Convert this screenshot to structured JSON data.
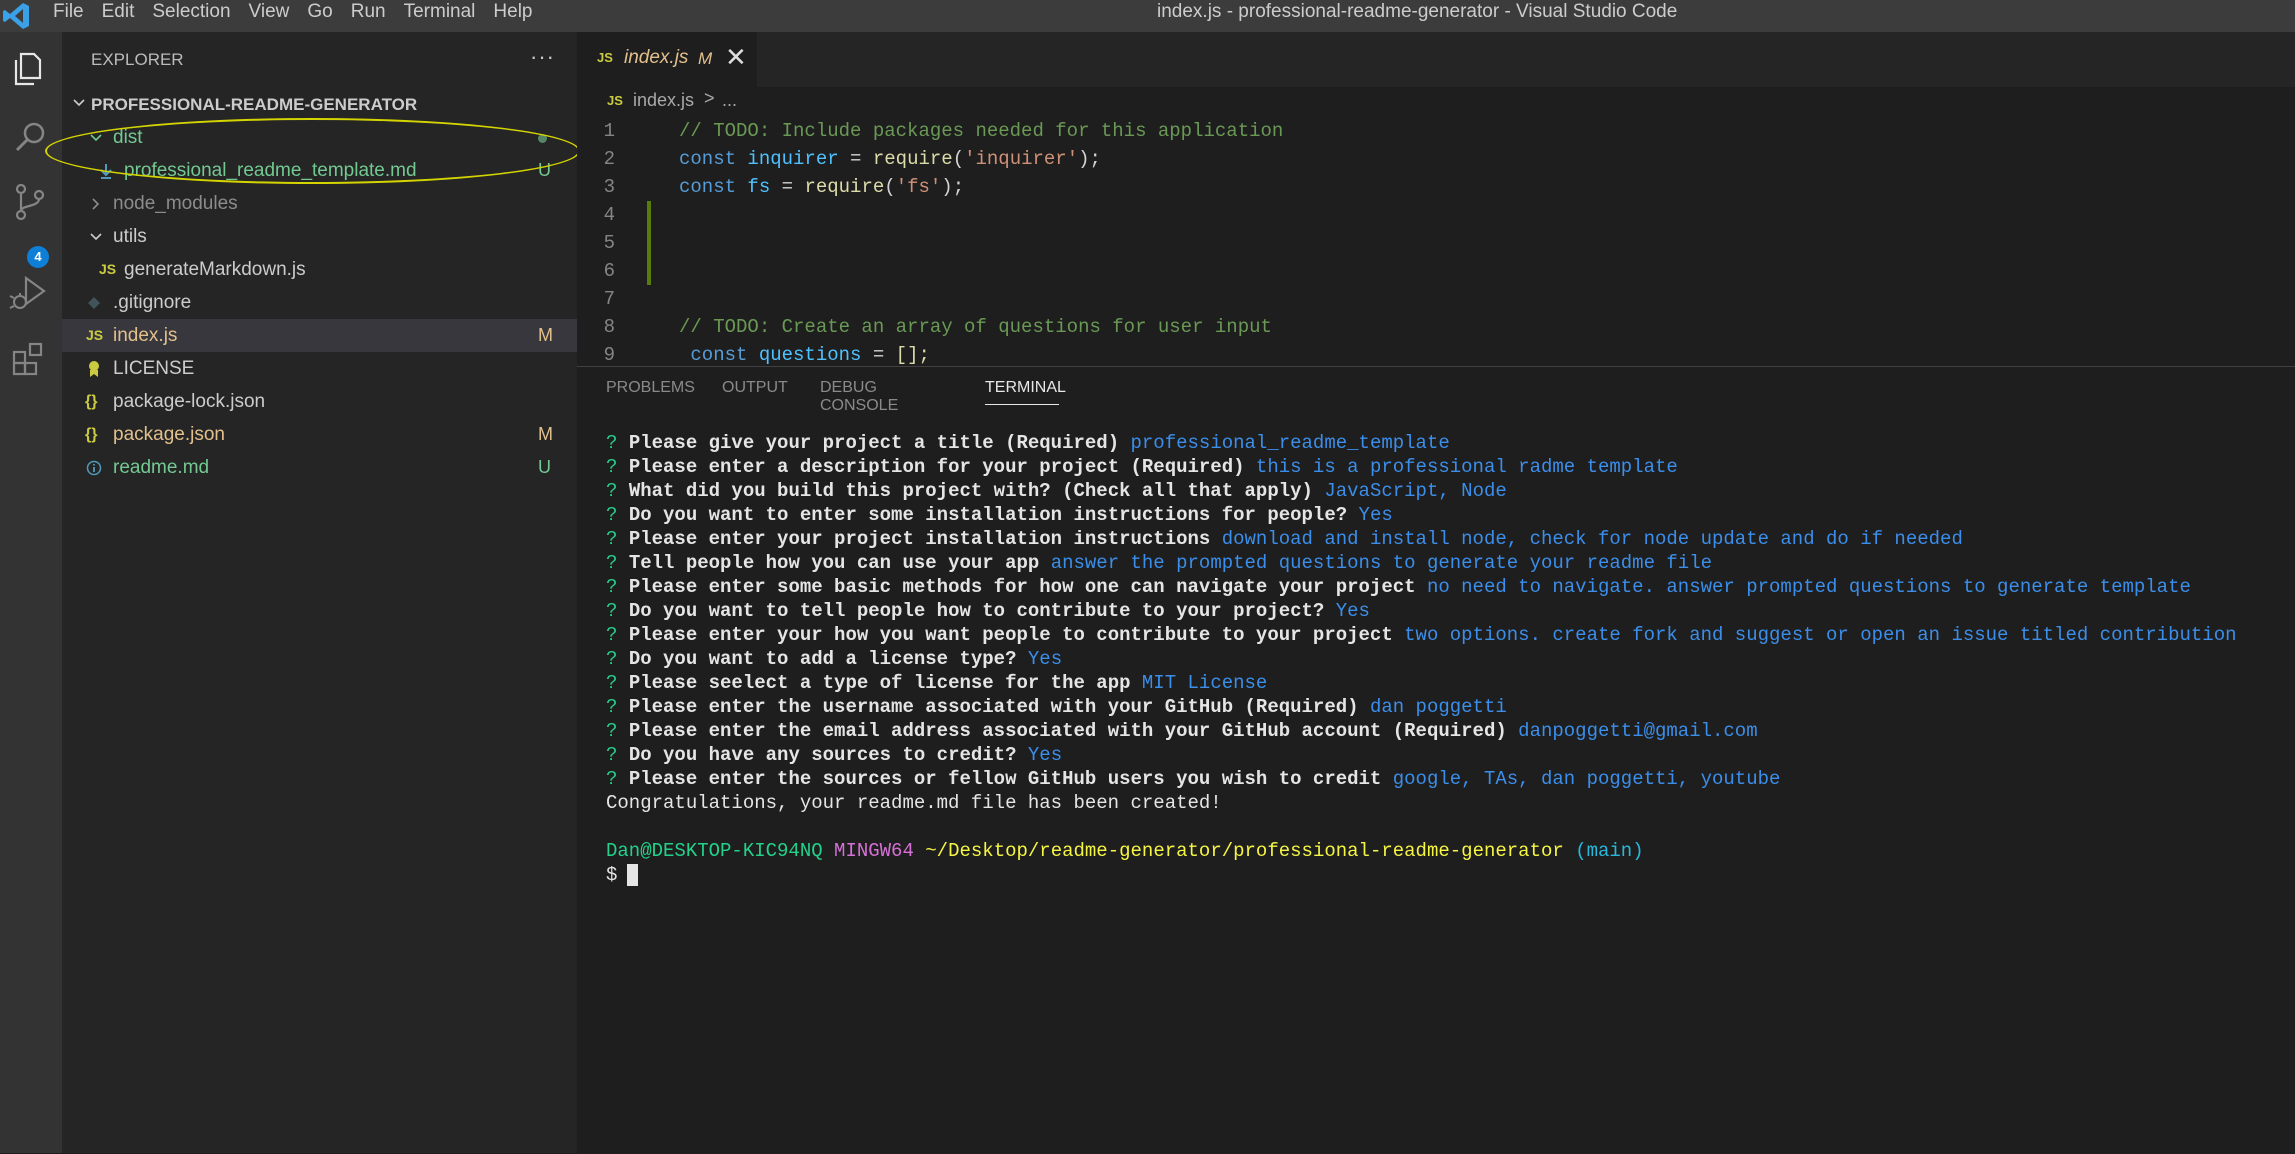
{
  "window": {
    "title": "index.js - professional-readme-generator - Visual Studio Code",
    "menu": [
      "File",
      "Edit",
      "Selection",
      "View",
      "Go",
      "Run",
      "Terminal",
      "Help"
    ]
  },
  "activity_bar": {
    "items": [
      "explorer-icon",
      "search-icon",
      "source-control-icon",
      "run-debug-icon",
      "extensions-icon"
    ],
    "scm_badge": "4"
  },
  "sidebar": {
    "title": "EXPLORER",
    "more": "···",
    "project": "PROFESSIONAL-README-GENERATOR",
    "tree": [
      {
        "label": "dist",
        "type": "folder",
        "expanded": true,
        "status": ""
      },
      {
        "label": "professional_readme_template.md",
        "type": "md",
        "status": "U"
      },
      {
        "label": "node_modules",
        "type": "folder",
        "expanded": false,
        "status": ""
      },
      {
        "label": "utils",
        "type": "folder",
        "expanded": true,
        "status": ""
      },
      {
        "label": "generateMarkdown.js",
        "type": "js",
        "status": ""
      },
      {
        "label": ".gitignore",
        "type": "git",
        "status": ""
      },
      {
        "label": "index.js",
        "type": "js",
        "status": "M"
      },
      {
        "label": "LICENSE",
        "type": "license",
        "status": ""
      },
      {
        "label": "package-lock.json",
        "type": "json",
        "status": ""
      },
      {
        "label": "package.json",
        "type": "json",
        "status": "M"
      },
      {
        "label": "readme.md",
        "type": "info",
        "status": "U"
      }
    ]
  },
  "editor": {
    "tab": {
      "icon": "JS",
      "name": "index.js",
      "modified": "M",
      "close": "✕"
    },
    "breadcrumb": {
      "icon": "JS",
      "file": "index.js",
      "sep": ">",
      "more": "..."
    },
    "lines": [
      {
        "n": "1",
        "text": "// TODO: Include packages needed for this application"
      },
      {
        "n": "2",
        "text": "const inquirer = require('inquirer');"
      },
      {
        "n": "3",
        "text": "const fs = require('fs');"
      },
      {
        "n": "4",
        "text": ""
      },
      {
        "n": "5",
        "text": ""
      },
      {
        "n": "6",
        "text": ""
      },
      {
        "n": "7",
        "text": ""
      },
      {
        "n": "8",
        "text": "// TODO: Create an array of questions for user input"
      },
      {
        "n": "9",
        "text": "const questions = [];"
      }
    ],
    "tokens": {
      "l1": "// TODO: Include packages needed for this application",
      "l2_kw": "const",
      "l2_var": "inquirer",
      "l2_eq": "=",
      "l2_fn": "require",
      "l2_p1": "(",
      "l2_str": "'inquirer'",
      "l2_p2": ");",
      "l3_kw": "const",
      "l3_var": "fs",
      "l3_eq": "=",
      "l3_fn": "require",
      "l3_p1": "(",
      "l3_str": "'fs'",
      "l3_p2": ");",
      "l8": "// TODO: Create an array of questions for user input",
      "l9_kw": "const",
      "l9_var": "questions",
      "l9_eq": "=",
      "l9_arr": "[];"
    }
  },
  "panel": {
    "tabs": [
      "PROBLEMS",
      "OUTPUT",
      "DEBUG CONSOLE",
      "TERMINAL"
    ],
    "active_tab": "TERMINAL",
    "terminal": {
      "lines": [
        {
          "q": "Please give your project a title (Required)",
          "a": "professional_readme_template"
        },
        {
          "q": "Please enter a description for your project (Required)",
          "a": "this is a professional radme template"
        },
        {
          "q": "What did you build this project with? (Check all that apply)",
          "a": "JavaScript, Node"
        },
        {
          "q": "Do you want to enter some installation instructions for people?",
          "a": "Yes"
        },
        {
          "q": "Please enter your project installation instructions",
          "a": "download and install node, check for node update and do if needed"
        },
        {
          "q": "Tell people how you can use your app",
          "a": "answer the prompted questions to generate your readme file"
        },
        {
          "q": "Please enter some basic methods for how one can navigate your project",
          "a": "no need to navigate. answer prompted questions to generate template"
        },
        {
          "q": "Do you want to tell people how to contribute to your project?",
          "a": "Yes"
        },
        {
          "q": "Please enter your how you want people to contribute to your project",
          "a": "two options. create fork and suggest or open an issue titled contribution"
        },
        {
          "q": "Do you want to add a license type?",
          "a": "Yes"
        },
        {
          "q": "Please seelect a type of license for the app",
          "a": "MIT License"
        },
        {
          "q": "Please enter the username associated with your GitHub (Required)",
          "a": "dan poggetti"
        },
        {
          "q": "Please enter the email address associated with your GitHub account (Required)",
          "a": "danpoggetti@gmail.com"
        },
        {
          "q": "Do you have any sources to credit?",
          "a": "Yes"
        },
        {
          "q": "Please enter the sources or fellow GitHub users you wish to credit",
          "a": "google, TAs, dan poggetti, youtube"
        }
      ],
      "prompt_mark": "?",
      "success": "Congratulations, your readme.md file has been created!",
      "user": "Dan@DESKTOP-KIC94NQ",
      "system": "MINGW64",
      "path": "~/Desktop/readme-generator/professional-readme-generator",
      "branch": "(main)",
      "shell_prompt": "$"
    }
  }
}
